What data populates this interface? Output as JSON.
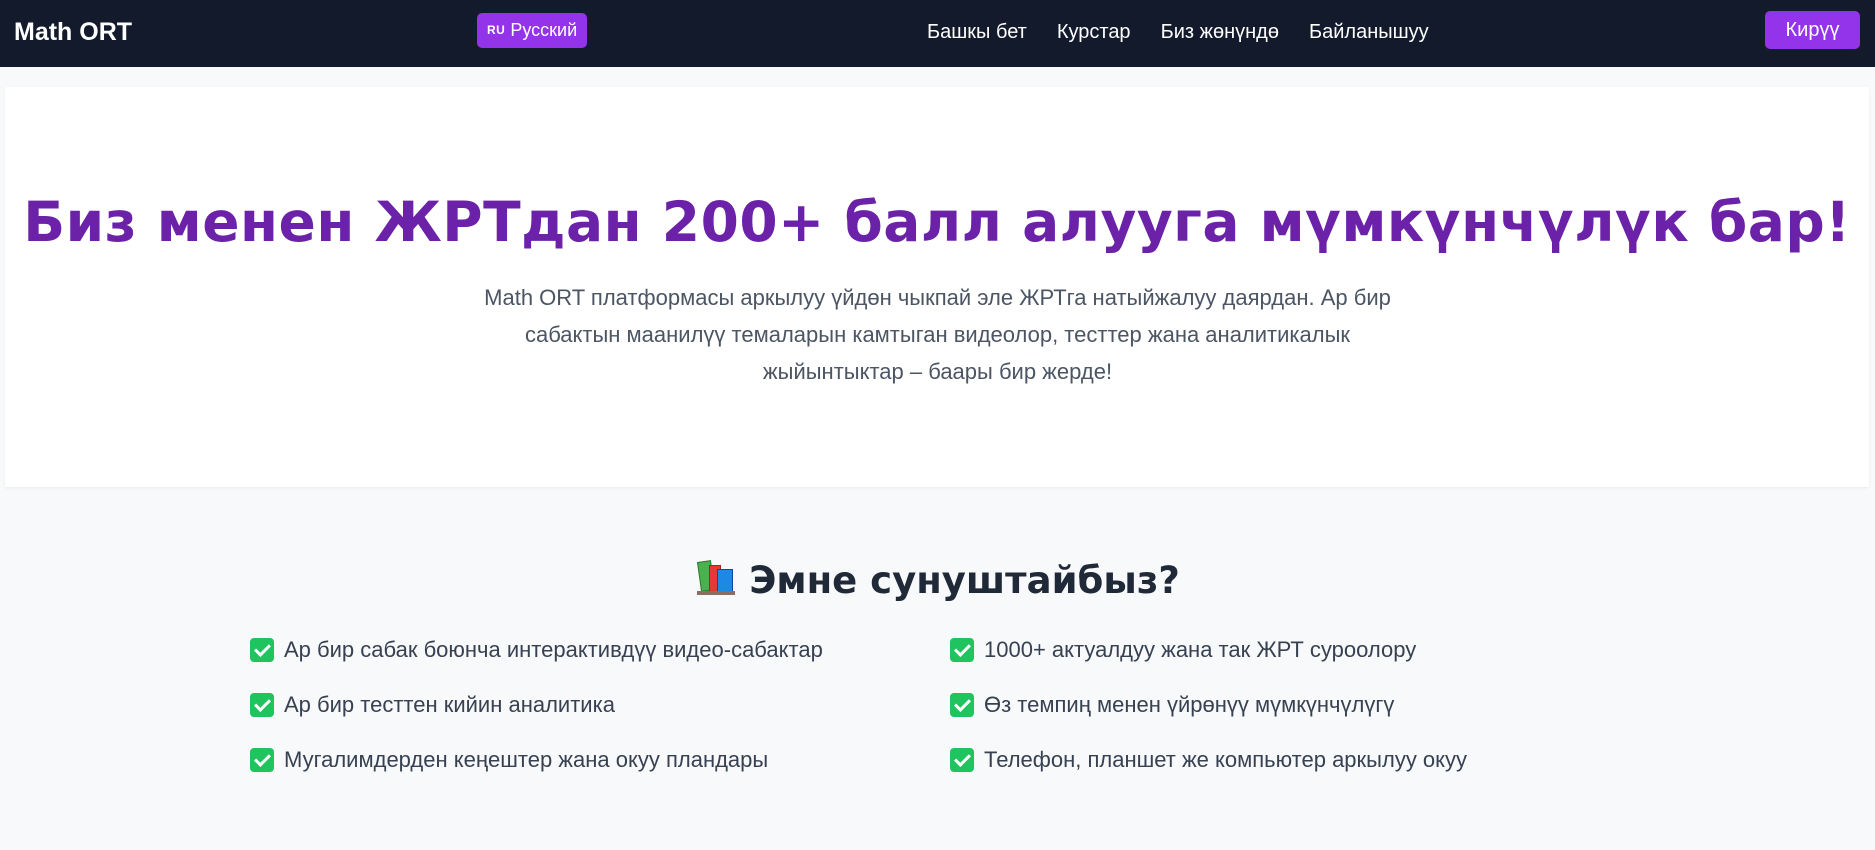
{
  "navbar": {
    "brand": "Math ORT",
    "lang_code": "RU",
    "lang_label": "Русский",
    "links": [
      "Башкы бет",
      "Курстар",
      "Биз жөнүндө",
      "Байланышуу"
    ],
    "login_label": "Кирүү"
  },
  "hero": {
    "title": "Биз менен ЖРТдан 200+ балл алууга мүмкүнчүлүк бар!",
    "text": "Math ORT платформасы аркылуу үйдөн чыкпай эле ЖРТга натыйжалуу даярдан. Ар бир сабактын маанилүү темаларын камтыган видеолор, тесттер жана аналитикалык жыйынтыктар – баары бир жерде!"
  },
  "features": {
    "icon": "books-icon",
    "title": "Эмне сунуштайбыз?",
    "items": [
      "Ар бир сабак боюнча интерактивдүү видео-сабактар",
      "1000+ актуалдуу жана так ЖРТ суроолору",
      "Ар бир тесттен кийин аналитика",
      "Өз темпиң менен үйрөнүү мүмкүнчүлүгү",
      "Мугалимдерден кеңештер жана окуу пландары",
      "Телефон, планшет же компьютер аркылуу окуу"
    ]
  },
  "colors": {
    "navbar_bg": "#121a2b",
    "accent": "#9333ea",
    "hero_title": "#6b21a8",
    "check": "#1fc45e"
  }
}
